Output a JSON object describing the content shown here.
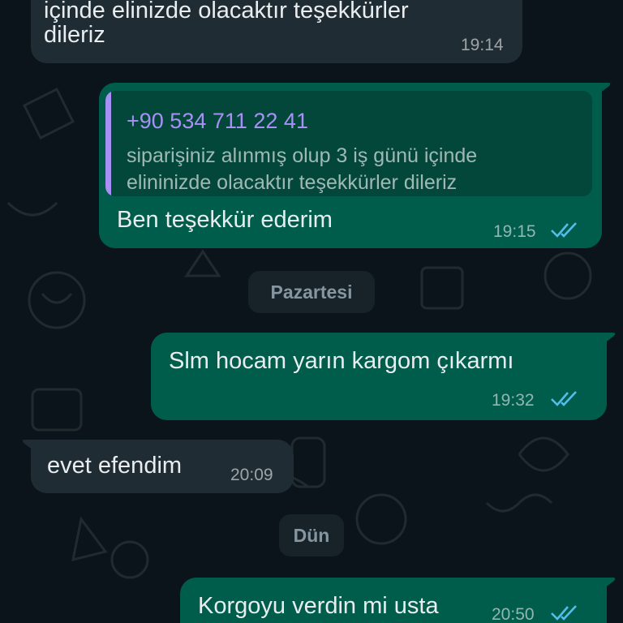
{
  "messages": [
    {
      "direction": "incoming",
      "lines": [
        "içinde elinizde olacaktır teşekkürler",
        "dileriz"
      ],
      "time": "19:14"
    },
    {
      "direction": "outgoing",
      "quote": {
        "author": "+90 534 711 22 41",
        "lines": [
          "siparişiniz alınmış olup 3 iş günü içinde",
          "elininizde olacaktır teşekkürler dileriz"
        ]
      },
      "text": "Ben teşekkür ederim",
      "time": "19:15",
      "status": "read"
    },
    {
      "direction": "outgoing",
      "text": "Slm hocam yarın kargom çıkarmı",
      "time": "19:32",
      "status": "read"
    },
    {
      "direction": "incoming",
      "text": "evet efendim",
      "time": "20:09"
    },
    {
      "direction": "outgoing",
      "text": "Korgoyu verdin mi usta",
      "time": "20:50",
      "status": "read"
    }
  ],
  "date_dividers": [
    "Pazartesi",
    "Dün"
  ],
  "colors": {
    "background": "#0b141a",
    "incoming_bubble": "#202c33",
    "outgoing_bubble": "#005c4b",
    "quote_accent": "#a791f7",
    "read_ticks": "#53bdeb"
  },
  "icons": {
    "read_status": "double-check-icon"
  }
}
